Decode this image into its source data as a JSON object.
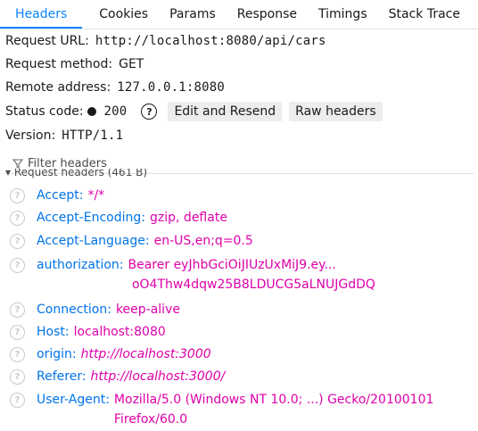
{
  "tabs": [
    "Headers",
    "Cookies",
    "Params",
    "Response",
    "Timings",
    "Stack Trace"
  ],
  "summary": {
    "request_url_label": "Request URL:",
    "request_url": "http://localhost:8080/api/cars",
    "request_method_label": "Request method:",
    "request_method": "GET",
    "remote_address_label": "Remote address:",
    "remote_address": "127.0.0.1:8080",
    "status_code_label": "Status code:",
    "status_code": "200",
    "edit_resend_label": "Edit and Resend",
    "raw_headers_label": "Raw headers",
    "version_label": "Version:",
    "version": "HTTP/1.1"
  },
  "filter": {
    "placeholder": "Filter headers"
  },
  "request_headers_title": "Request headers (461 B)",
  "headers": [
    {
      "name": "Accept:",
      "value": "*/*",
      "italic": false
    },
    {
      "name": "Accept-Encoding:",
      "value": "gzip, deflate",
      "italic": false
    },
    {
      "name": "Accept-Language:",
      "value": "en-US,en;q=0.5",
      "italic": false
    },
    {
      "name": "authorization:",
      "value": "Bearer eyJhbGciOiJIUzUxMiJ9.ey...\n oO4Thw4dqw25B8LDUCG5aLNUJGdDQ",
      "italic": false
    },
    {
      "name": "Connection:",
      "value": "keep-alive",
      "italic": false
    },
    {
      "name": "Host:",
      "value": "localhost:8080",
      "italic": false
    },
    {
      "name": "origin:",
      "value": "http://localhost:3000",
      "italic": true
    },
    {
      "name": "Referer:",
      "value": "http://localhost:3000/",
      "italic": true
    },
    {
      "name": "User-Agent:",
      "value": "Mozilla/5.0 (Windows NT 10.0; ...) Gecko/20100101\nFirefox/60.0",
      "italic": false
    }
  ],
  "colors": {
    "accent": "#0a84ff",
    "header_name": "#0074e8",
    "header_value": "#dd00a9"
  }
}
